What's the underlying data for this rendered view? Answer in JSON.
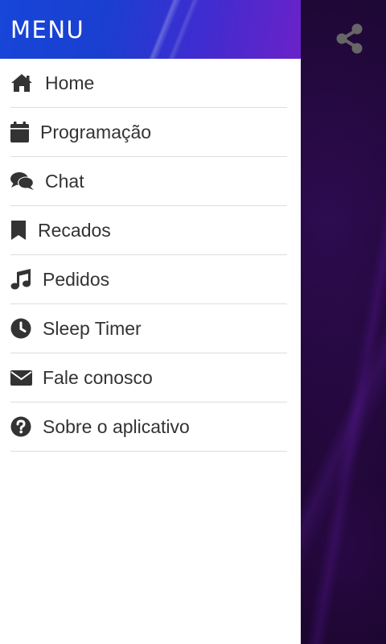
{
  "drawer": {
    "title": "MENU",
    "items": [
      {
        "label": "Home",
        "icon": "home-icon"
      },
      {
        "label": "Programação",
        "icon": "calendar-icon"
      },
      {
        "label": "Chat",
        "icon": "chat-icon"
      },
      {
        "label": "Recados",
        "icon": "bookmark-icon"
      },
      {
        "label": "Pedidos",
        "icon": "music-icon"
      },
      {
        "label": "Sleep Timer",
        "icon": "clock-icon"
      },
      {
        "label": "Fale conosco",
        "icon": "envelope-icon"
      },
      {
        "label": "Sobre o aplicativo",
        "icon": "question-circle-icon"
      }
    ]
  },
  "toolbar": {
    "share_icon": "share-icon"
  },
  "colors": {
    "header_gradient_start": "#1746d8",
    "header_gradient_end": "#6a22c8",
    "menu_text": "#333333",
    "icon": "#333333",
    "divider": "#dddddd",
    "background_dark": "#12041f",
    "share_icon": "#666666"
  }
}
